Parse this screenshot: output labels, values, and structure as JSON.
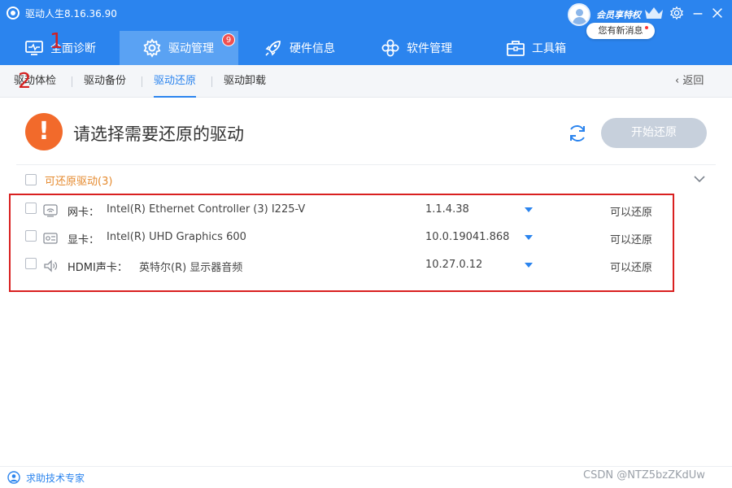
{
  "app": {
    "title": "驱动人生8.16.36.90"
  },
  "account": {
    "vip_label": "会员享特权",
    "message_bubble": "您有新消息"
  },
  "nav": {
    "tabs": [
      {
        "label": "全面诊断"
      },
      {
        "label": "驱动管理",
        "badge": "9"
      },
      {
        "label": "硬件信息"
      },
      {
        "label": "软件管理"
      },
      {
        "label": "工具箱"
      }
    ],
    "active": "驱动管理"
  },
  "annotations": {
    "marker_1": "1",
    "marker_2": "2"
  },
  "subnav": {
    "tabs": [
      {
        "label": "驱动体检"
      },
      {
        "label": "驱动备份"
      },
      {
        "label": "驱动还原"
      },
      {
        "label": "驱动卸载"
      }
    ],
    "active": "驱动还原",
    "back_label": "返回"
  },
  "main": {
    "title": "请选择需要还原的驱动",
    "start_button": "开始还原",
    "group_label": "可还原驱动(3)"
  },
  "drivers": [
    {
      "type": "网卡：",
      "name": "Intel(R) Ethernet Controller (3) I225-V",
      "version": "1.1.4.38",
      "status": "可以还原",
      "icon": "network-card-icon"
    },
    {
      "type": "显卡：",
      "name": "Intel(R) UHD Graphics 600",
      "version": "10.0.19041.868",
      "status": "可以还原",
      "icon": "graphics-card-icon"
    },
    {
      "type": "HDMI声卡：",
      "name": "英特尔(R) 显示器音频",
      "version": "10.27.0.12",
      "status": "可以还原",
      "icon": "speaker-icon"
    }
  ],
  "footer": {
    "help_text": "求助技术专家",
    "watermark": "CSDN @NTZ5bzZKdUw"
  },
  "colors": {
    "header_blue": "#2b84ee",
    "active_tab": "#5aa2f3",
    "warning_orange": "#f26a2b",
    "highlight_red": "#d92020"
  }
}
